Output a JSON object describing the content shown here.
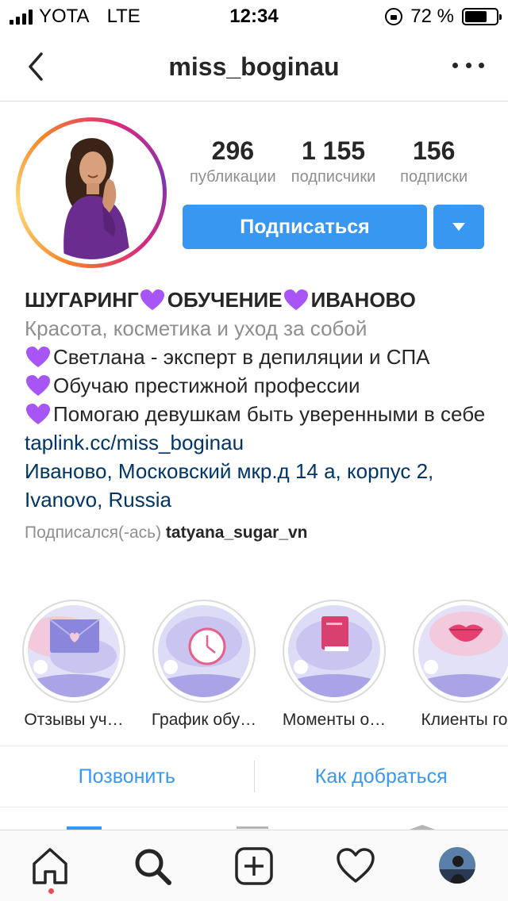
{
  "status_bar": {
    "carrier": "YOTA",
    "network": "LTE",
    "time": "12:34",
    "battery_text": "72 %",
    "battery_level": 0.72
  },
  "header": {
    "username": "miss_boginau",
    "back_icon": "chevron-left-icon",
    "more_icon": "more-horizontal-icon"
  },
  "profile": {
    "stats": [
      {
        "value": "296",
        "label": "публикации"
      },
      {
        "value": "1 155",
        "label": "подписчики"
      },
      {
        "value": "156",
        "label": "подписки"
      }
    ],
    "subscribe_label": "Подписаться",
    "accent_color": "#3897f0"
  },
  "bio": {
    "name_parts": [
      "ШУГАРИНГ",
      "ОБУЧЕНИЕ",
      "ИВАНОВО"
    ],
    "category": "Красота, косметика и уход за собой",
    "lines": [
      "Светлана - эксперт в депиляции и СПА",
      "Обучаю престижной профессии",
      "Помогаю девушкам быть уверенными в себе"
    ],
    "link": "taplink.cc/miss_boginau",
    "address": "Иваново, Московский мкр.д 14 а, корпус 2, Ivanovo, Russia",
    "followed_by_prefix": "Подписался(-ась)",
    "followed_by_user": "tatyana_sugar_vn"
  },
  "highlights": [
    {
      "label": "Отзывы уч…",
      "icon": "envelope-heart-icon"
    },
    {
      "label": "График обу…",
      "icon": "clock-icon"
    },
    {
      "label": "Моменты о…",
      "icon": "book-icon"
    },
    {
      "label": "Клиенты го",
      "icon": "lips-icon"
    }
  ],
  "contact": {
    "call_label": "Позвонить",
    "directions_label": "Как добраться"
  },
  "tabbar": {
    "items": [
      "home-icon",
      "search-icon",
      "add-post-icon",
      "heart-icon",
      "profile-avatar"
    ]
  }
}
